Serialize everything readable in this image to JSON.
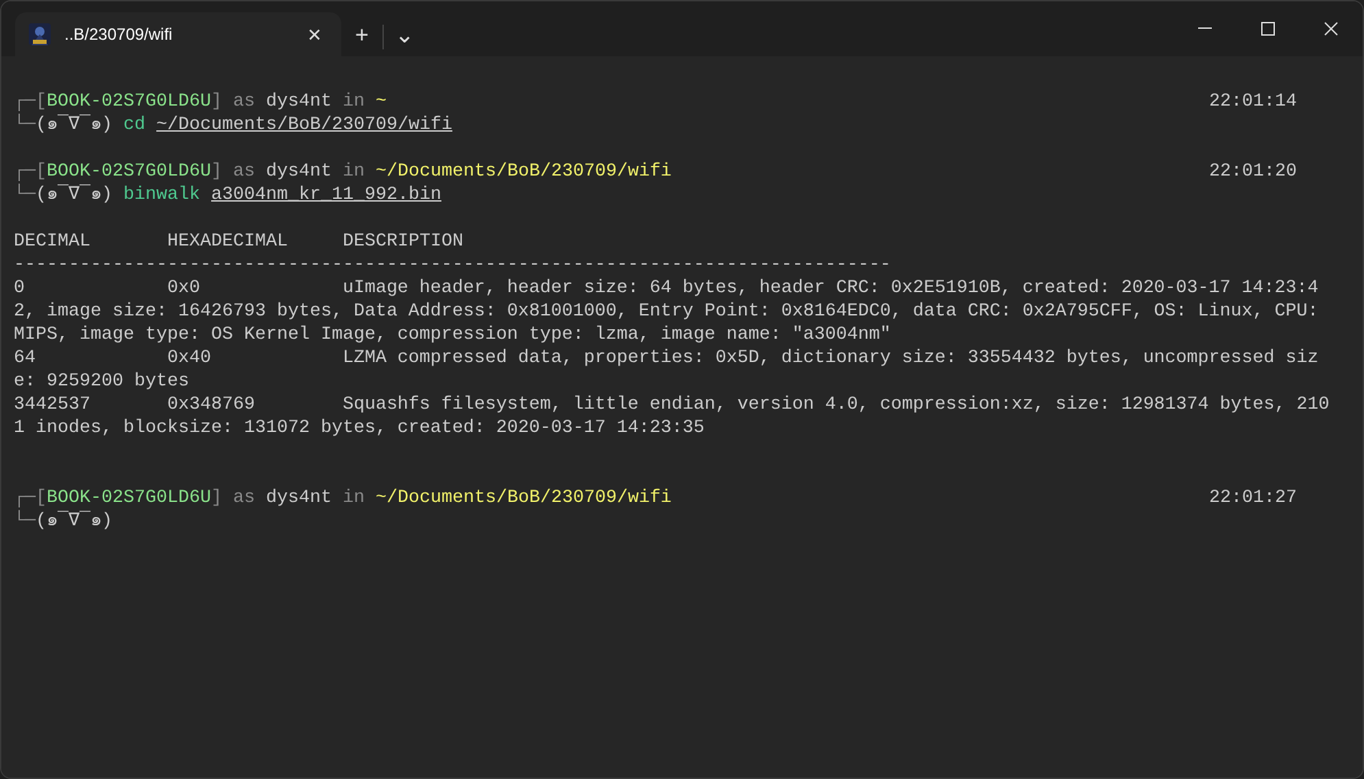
{
  "tabs": [
    {
      "title": "..B/230709/wifi",
      "selected": true,
      "close": "✕"
    }
  ],
  "tab_actions": {
    "new_tab": "+",
    "dropdown": "⌄"
  },
  "terminal": [
    {
      "kind": "prompt",
      "corner_top": "┌─",
      "corner_bottom": "└─",
      "bracket_open": "[",
      "host": "BOOK-02S7G0LD6U",
      "bracket_close": "]",
      "as_word": "as",
      "user": "dys4nt",
      "in_word": "in",
      "path": "~",
      "time": "22:01:14",
      "face": "(๑¯∇¯๑)",
      "command": "cd",
      "argument": "~/Documents/BoB/230709/wifi"
    },
    {
      "kind": "blank"
    },
    {
      "kind": "prompt",
      "corner_top": "┌─",
      "corner_bottom": "└─",
      "bracket_open": "[",
      "host": "BOOK-02S7G0LD6U",
      "bracket_close": "]",
      "as_word": "as",
      "user": "dys4nt",
      "in_word": "in",
      "path": "~/Documents/BoB/230709/wifi",
      "time": "22:01:20",
      "face": "(๑¯∇¯๑)",
      "command": "binwalk",
      "argument": "a3004nm_kr_11_992.bin"
    },
    {
      "kind": "blank"
    },
    {
      "kind": "output",
      "columns": [
        "DECIMAL",
        "HEXADECIMAL",
        "DESCRIPTION"
      ],
      "rule": "--------------------------------------------------------------------------------",
      "rows": [
        {
          "decimal": "0",
          "hexadecimal": "0x0",
          "description": "uImage header, header size: 64 bytes, header CRC: 0x2E51910B, created: 2020-03-17 14:23:42, image size: 16426793 bytes, Data Address: 0x81001000, Entry Point: 0x8164EDC0, data CRC: 0x2A795CFF, OS: Linux, CPU: MIPS, image type: OS Kernel Image, compression type: lzma, image name: \"a3004nm\""
        },
        {
          "decimal": "64",
          "hexadecimal": "0x40",
          "description": "LZMA compressed data, properties: 0x5D, dictionary size: 33554432 bytes, uncompressed size: 9259200 bytes"
        },
        {
          "decimal": "3442537",
          "hexadecimal": "0x348769",
          "description": "Squashfs filesystem, little endian, version 4.0, compression:xz, size: 12981374 bytes, 2101 inodes, blocksize: 131072 bytes, created: 2020-03-17 14:23:35"
        }
      ]
    },
    {
      "kind": "blank"
    },
    {
      "kind": "blank"
    },
    {
      "kind": "prompt",
      "corner_top": "┌─",
      "corner_bottom": "└─",
      "bracket_open": "[",
      "host": "BOOK-02S7G0LD6U",
      "bracket_close": "]",
      "as_word": "as",
      "user": "dys4nt",
      "in_word": "in",
      "path": "~/Documents/BoB/230709/wifi",
      "time": "22:01:27",
      "face": "(๑¯∇¯๑)"
    }
  ]
}
